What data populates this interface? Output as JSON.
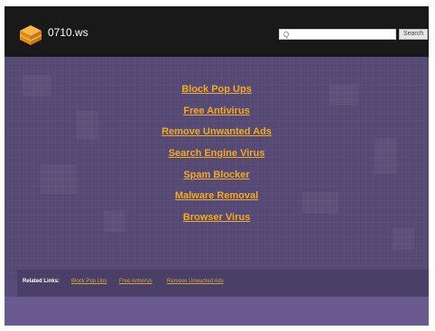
{
  "header": {
    "site_name": "0710.ws",
    "search_placeholder": "Q",
    "search_button": "Search"
  },
  "links": [
    "Block Pop Ups",
    "Free Antivirus",
    "Remove Unwanted Ads",
    "Search Engine Virus",
    "Spam Blocker",
    "Malware Removal",
    "Browser Virus"
  ],
  "footer": {
    "label": "Related Links:",
    "links": [
      "Block Pop Ups",
      "Free Antivirus",
      "Remove Unwanted Ads"
    ]
  },
  "colors": {
    "link": "#f2a928",
    "header_bg": "#191919",
    "main_bg": "#564a74"
  }
}
